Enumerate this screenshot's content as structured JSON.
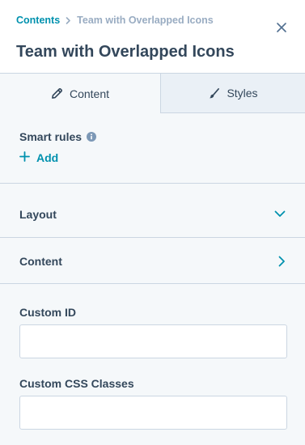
{
  "header": {
    "breadcrumb_root": "Contents",
    "breadcrumb_current": "Team with Overlapped Icons",
    "title": "Team with Overlapped Icons"
  },
  "tabs": [
    {
      "label": "Content",
      "icon": "pencil-icon",
      "active": true
    },
    {
      "label": "Styles",
      "icon": "brush-icon",
      "active": false
    }
  ],
  "smart_rules": {
    "label": "Smart rules",
    "add_label": "Add"
  },
  "sections": [
    {
      "label": "Layout",
      "icon": "chevron-down-icon"
    },
    {
      "label": "Content",
      "icon": "chevron-right-icon"
    }
  ],
  "fields": {
    "custom_id": {
      "label": "Custom ID",
      "value": ""
    },
    "custom_css_classes": {
      "label": "Custom CSS Classes",
      "value": ""
    }
  },
  "colors": {
    "accent": "#0091ae",
    "text": "#33475b",
    "muted": "#99acc2",
    "border": "#cbd6e2",
    "panel_bg": "#f5f8fa",
    "inactive_tab_bg": "#eaf0f6"
  }
}
